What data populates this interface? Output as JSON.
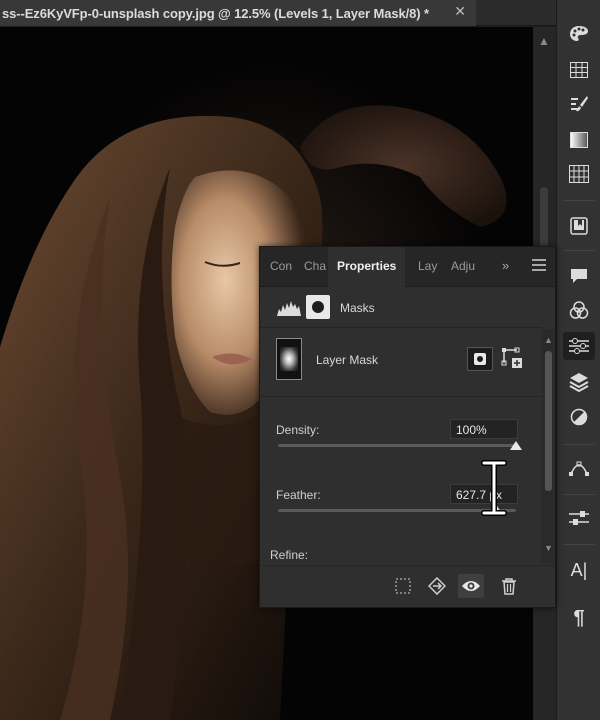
{
  "document": {
    "tab_title": "ss--Ez6KyVFp-0-unsplash copy.jpg @ 12.5% (Levels 1, Layer Mask/8) *",
    "close_glyph": "✕"
  },
  "right_toolbar": {
    "icons": [
      "color-palette-icon",
      "swatches-grid-icon",
      "brush-presets-icon",
      "gradients-icon",
      "patterns-icon",
      "libraries-icon",
      "comments-icon",
      "channels-icon",
      "adjustments-properties-icon",
      "layers-icon",
      "adjustments-circle-icon",
      "paths-icon",
      "adjustments-sliders-icon",
      "character-icon",
      "paragraph-icon"
    ],
    "active": "adjustments-properties-icon",
    "character_glyph": "A|",
    "paragraph_glyph": "¶"
  },
  "panel": {
    "tabs": [
      "Con",
      "Cha",
      "Properties",
      "Lay",
      "Adju"
    ],
    "active_tab": "Properties",
    "more_glyph": "»",
    "section_label": "Masks",
    "layer_mask_label": "Layer Mask",
    "density": {
      "label": "Density:",
      "value": "100%",
      "level": 1.0
    },
    "feather": {
      "label": "Feather:",
      "value": "627.7 px",
      "level": 0.92
    },
    "refine_label": "Refine:",
    "footer_icons": [
      "load-selection-icon",
      "apply-mask-icon",
      "visibility-eye-icon",
      "delete-mask-icon"
    ]
  },
  "colors": {
    "panel_bg": "#2f2f2f",
    "toolbar_bg": "#323232",
    "accent_text": "#f0f0f0"
  }
}
